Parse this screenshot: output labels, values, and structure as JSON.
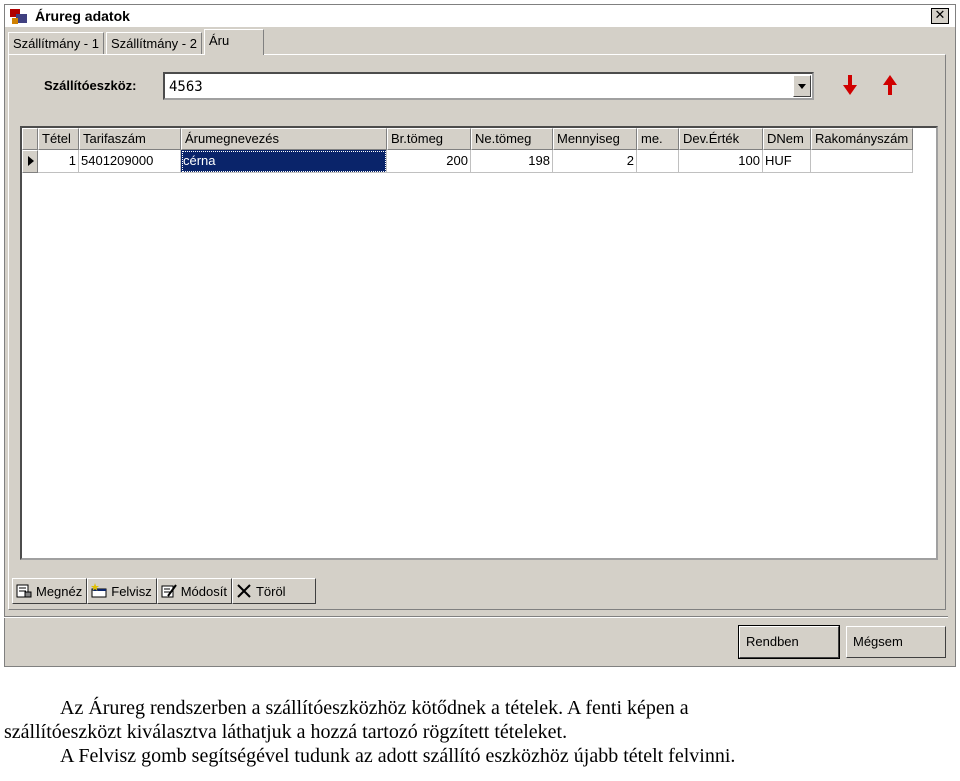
{
  "window": {
    "title": "Árureg adatok",
    "close_glyph": "✕"
  },
  "tabs": [
    {
      "label": "Szállítmány - 1"
    },
    {
      "label": "Szállítmány - 2"
    },
    {
      "label": "Áru",
      "active": true
    }
  ],
  "carrier": {
    "label": "Szállítóeszköz:",
    "value": "4563"
  },
  "grid": {
    "columns": [
      "Tétel",
      "Tarifaszám",
      "Árumegnevezés",
      "Br.tömeg",
      "Ne.tömeg",
      "Mennyiseg",
      "me.",
      "Dev.Érték",
      "DNem",
      "Rakományszám"
    ],
    "rows": [
      [
        "1",
        "5401209000",
        "cérna",
        "200",
        "198",
        "2",
        "",
        "100",
        "HUF",
        ""
      ]
    ]
  },
  "toolbar": {
    "view": "Megnéz",
    "add": "Felvisz",
    "edit": "Módosít",
    "delete": "Töröl"
  },
  "buttons": {
    "ok": "Rendben",
    "cancel": "Mégsem"
  },
  "caption": {
    "line1": "Az Árureg rendszerben a szállítóeszközhöz kötődnek a tételek. A fenti képen a",
    "line2": "szállítóeszközt kiválasztva láthatjuk a hozzá tartozó rögzített tételeket.",
    "line3": "A Felvisz gomb segítségével tudunk az adott szállító eszközhöz újabb tételt felvinni."
  },
  "colors": {
    "accent": "#0a246a",
    "arrow": "#d00000",
    "face": "#d4d0c8"
  }
}
